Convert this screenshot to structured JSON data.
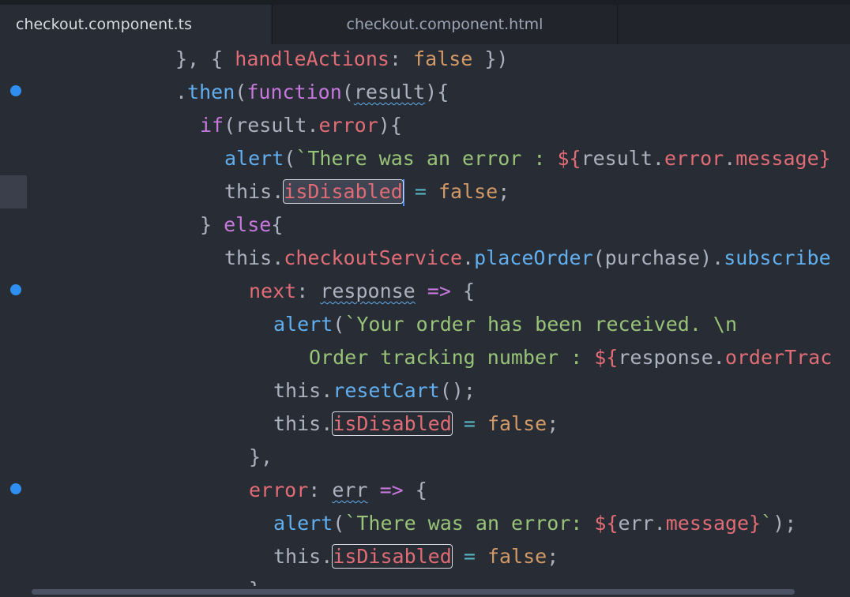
{
  "tabs": [
    {
      "label": "checkout.component.ts",
      "active": true
    },
    {
      "label": "checkout.component.html",
      "active": false
    }
  ],
  "colors": {
    "background": "#282c34",
    "property": "#e06c75",
    "keyword": "#c678dd",
    "function": "#61afef",
    "boolean": "#d19a66",
    "string": "#98c379",
    "breakpoint_dot": "#2e8ff0"
  },
  "code": {
    "l1": {
      "a": "}, { ",
      "b": "handleActions",
      "c": ": ",
      "d": "false",
      "e": " })"
    },
    "l2": {
      "a": ".",
      "b": "then",
      "c": "(",
      "d": "function",
      "e": "(",
      "f": "result",
      "g": "){"
    },
    "l3": {
      "a": "if",
      "b": "(result.",
      "c": "error",
      "d": "){"
    },
    "l4": {
      "a": "alert",
      "b": "(",
      "c": "`There was an error : ",
      "d": "${",
      "e": "result.",
      "f": "error",
      "g": ".",
      "h": "message",
      "i": "}"
    },
    "l5": {
      "a": "this.",
      "b": "isDisabled",
      "c": " = ",
      "d": "false",
      "e": ";"
    },
    "l6": {
      "a": "} ",
      "b": "else",
      "c": "{"
    },
    "l7": {
      "a": "this.",
      "b": "checkoutService",
      "c": ".",
      "d": "placeOrder",
      "e": "(purchase).",
      "f": "subscribe"
    },
    "l8": {
      "a": "next",
      "b": ": ",
      "c": "response",
      "d": " => ",
      "e": "{"
    },
    "l9": {
      "a": "alert",
      "b": "(",
      "c": "`Your order has been received. \\n"
    },
    "l10": {
      "a": "Order tracking number : ",
      "b": "${",
      "c": "response.",
      "d": "orderTrac"
    },
    "l11": {
      "a": "this.",
      "b": "resetCart",
      "c": "();"
    },
    "l12": {
      "a": "this.",
      "b": "isDisabled",
      "c": " = ",
      "d": "false",
      "e": ";"
    },
    "l13": {
      "a": "},"
    },
    "l14": {
      "a": "error",
      "b": ": ",
      "c": "err",
      "d": " => ",
      "e": "{"
    },
    "l15": {
      "a": "alert",
      "b": "(",
      "c": "`There was an error: ",
      "d": "${",
      "e": "err.",
      "f": "message",
      "g": "}",
      "h": "`",
      "i": ");"
    },
    "l16": {
      "a": "this.",
      "b": "isDisabled",
      "c": " = ",
      "d": "false",
      "e": ";"
    },
    "l17": {
      "a": "}"
    }
  }
}
